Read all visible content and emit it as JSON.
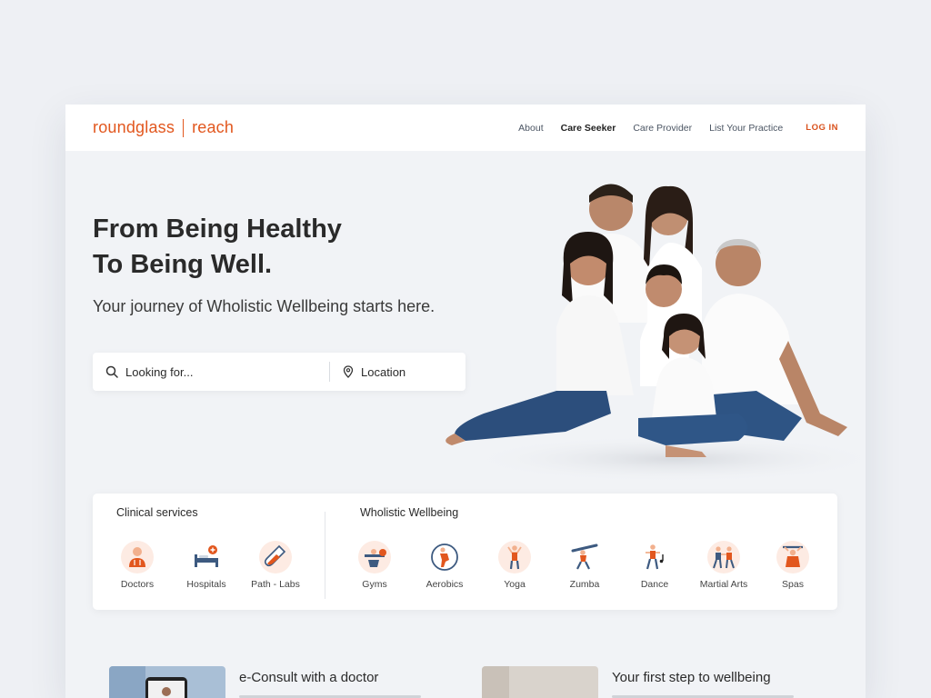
{
  "header": {
    "logo_brand": "roundglass",
    "logo_sub": "reach",
    "nav": [
      "About",
      "Care Seeker",
      "Care Provider",
      "List Your Practice"
    ],
    "login": "LOG IN"
  },
  "hero": {
    "title_line1": "From Being Healthy",
    "title_line2": "To Being Well.",
    "subtitle": "Your journey of Wholistic Wellbeing starts here."
  },
  "search": {
    "looking_placeholder": "Looking for...",
    "location_placeholder": "Location"
  },
  "clinical": {
    "title": "Clinical services",
    "items": [
      {
        "label": "Doctors",
        "icon": "doctor-icon"
      },
      {
        "label": "Hospitals",
        "icon": "hospital-bed-icon"
      },
      {
        "label": "Path - Labs",
        "icon": "test-tube-icon"
      }
    ]
  },
  "wellbeing": {
    "title": "Wholistic Wellbeing",
    "items": [
      {
        "label": "Gyms",
        "icon": "gym-icon"
      },
      {
        "label": "Aerobics",
        "icon": "aerobics-icon"
      },
      {
        "label": "Yoga",
        "icon": "yoga-icon"
      },
      {
        "label": "Zumba",
        "icon": "zumba-icon"
      },
      {
        "label": "Dance",
        "icon": "dance-icon"
      },
      {
        "label": "Martial Arts",
        "icon": "martial-arts-icon"
      },
      {
        "label": "Spas",
        "icon": "spa-icon"
      }
    ]
  },
  "promos": [
    {
      "title": "e-Consult with a doctor"
    },
    {
      "title": "Your first step to wellbeing"
    }
  ],
  "colors": {
    "accent": "#e2571e",
    "background": "#eef0f4",
    "card": "#f1f3f6"
  }
}
